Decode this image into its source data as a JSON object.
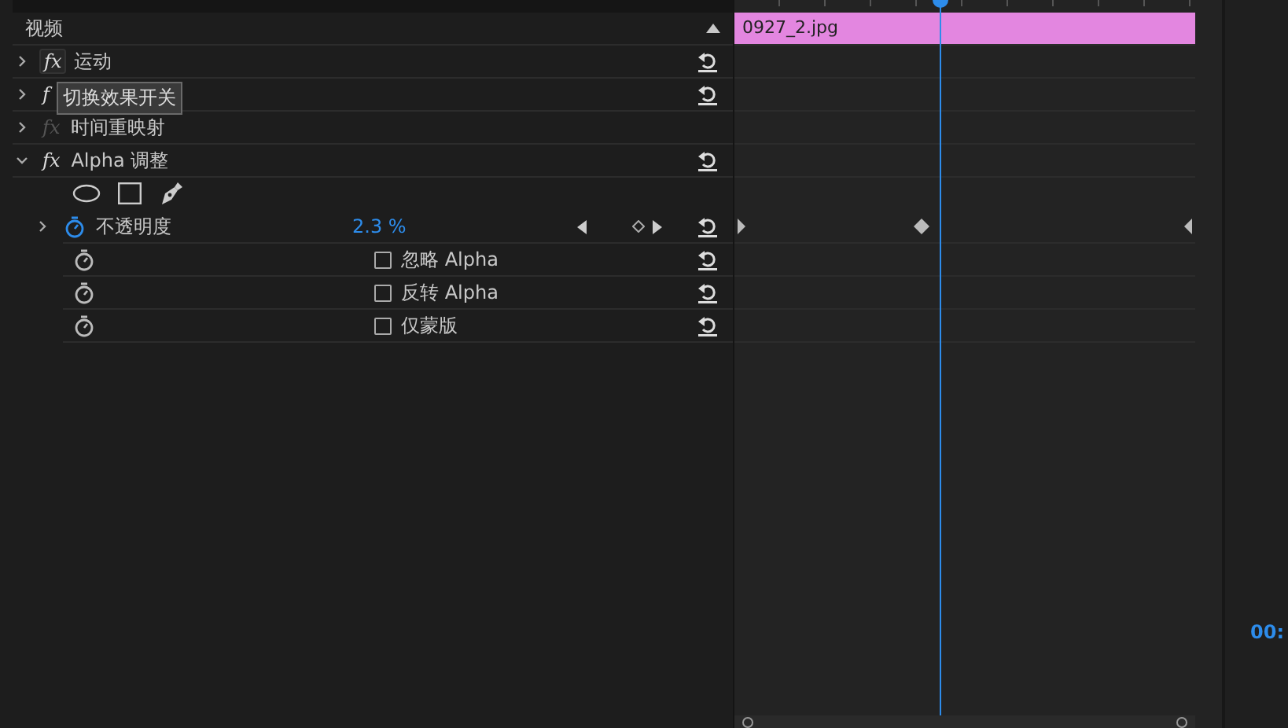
{
  "section": {
    "title": "视频"
  },
  "tooltip": {
    "text": "切换效果开关"
  },
  "effects": [
    {
      "toggle": "fx",
      "label": "运动",
      "expanded": false,
      "enabled": true
    },
    {
      "toggle": "f",
      "expanded": false,
      "enabled": true
    },
    {
      "toggle": "fx",
      "label": "时间重映射",
      "expanded": false,
      "enabled": false
    },
    {
      "toggle": "fx",
      "label": "Alpha 调整",
      "expanded": true,
      "enabled": true,
      "children": [
        {
          "kind": "mask_tools"
        },
        {
          "kind": "value",
          "label": "不透明度",
          "value": "2.3 %",
          "expanded": false,
          "animated": true
        },
        {
          "kind": "checkbox",
          "label": "忽略 Alpha",
          "checked": false,
          "animated": false
        },
        {
          "kind": "checkbox",
          "label": "反转 Alpha",
          "checked": false,
          "animated": false
        },
        {
          "kind": "checkbox",
          "label": "仅蒙版",
          "checked": false,
          "animated": false
        }
      ]
    }
  ],
  "clip": {
    "label": "0927_2.jpg",
    "color": "#e386e0"
  },
  "timecode": "00:"
}
